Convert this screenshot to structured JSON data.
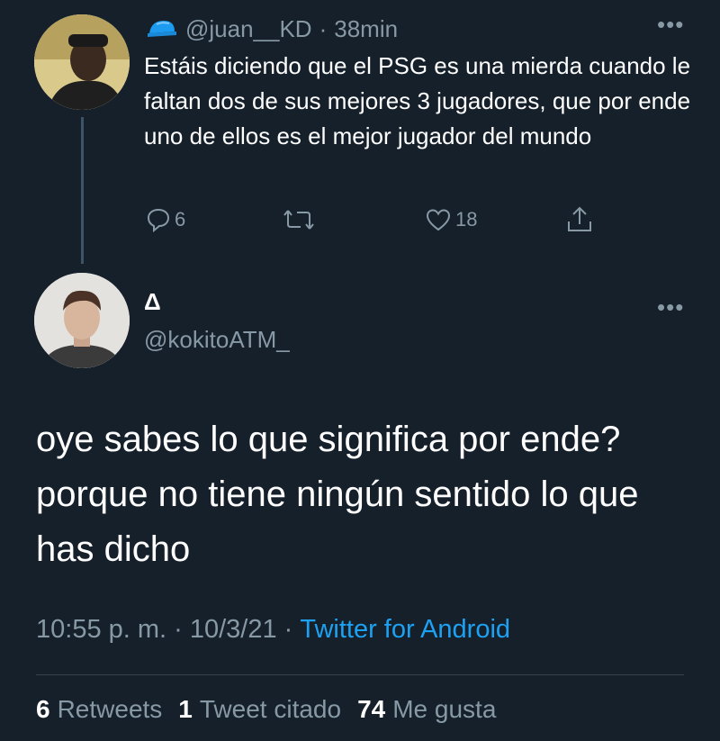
{
  "reply_parent": {
    "handle": "@juan__KD",
    "time": "38min",
    "text": "Estáis diciendo que el PSG es una mierda cuando le faltan dos de sus mejores 3 jugadores, que por ende uno de ellos es el mejor jugador del mundo",
    "replies": "6",
    "likes": "18",
    "badge_icon": "blue-cap-icon"
  },
  "tweet": {
    "display_name": "Δ",
    "handle": "@kokitoATM_",
    "text": "oye sabes lo que significa por ende? porque no tiene ningún sentido lo que has dicho",
    "timestamp": "10:55 p. m. · 10/3/21 ·",
    "source": "Twitter for Android"
  },
  "stats": {
    "retweets_count": "6",
    "retweets_label": "Retweets",
    "quotes_count": "1",
    "quotes_label": "Tweet citado",
    "likes_count": "74",
    "likes_label": "Me gusta"
  },
  "colors": {
    "background": "#15202b",
    "secondary_text": "#8899a6",
    "link": "#1da1f2"
  }
}
